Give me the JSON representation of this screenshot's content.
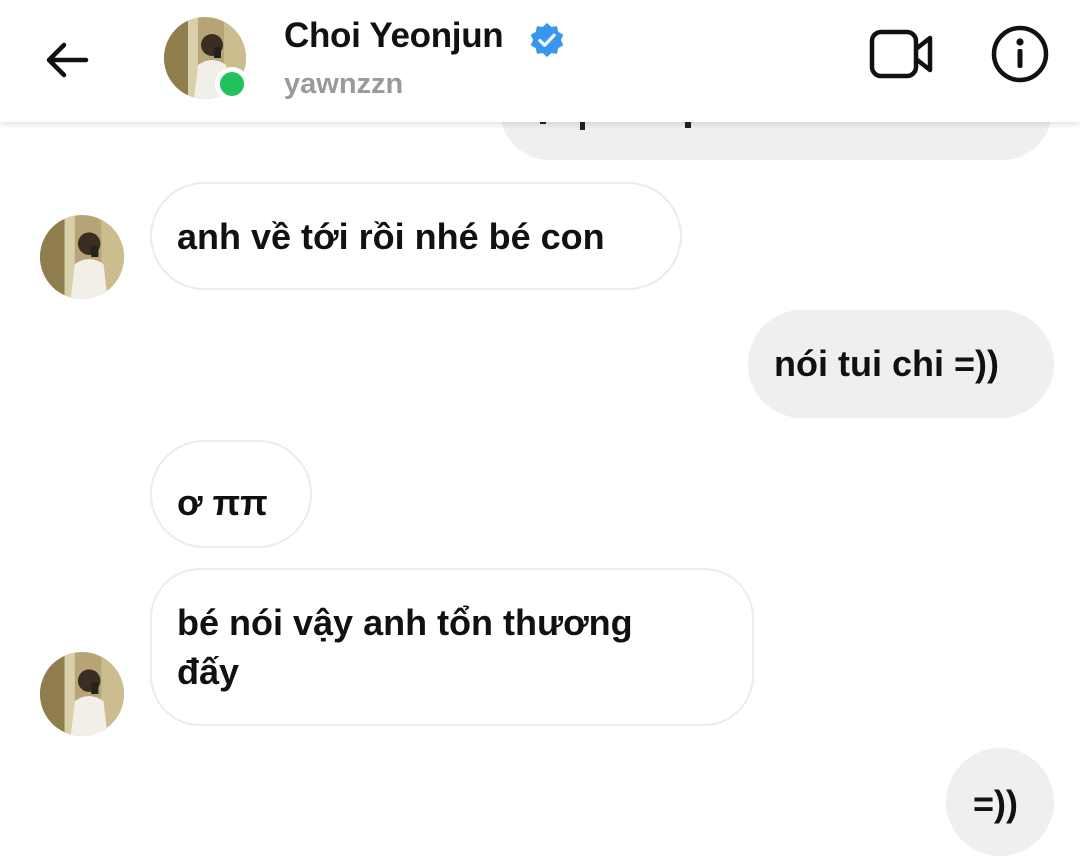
{
  "header": {
    "name": "Choi Yeonjun",
    "username": "yawnzzn",
    "verified": true,
    "online": true,
    "icons": {
      "back": "back-arrow-icon",
      "verified": "verified-badge-icon",
      "video": "video-call-icon",
      "info": "info-icon"
    }
  },
  "colors": {
    "online": "#21c25e",
    "verified": "#3797f0",
    "outgoing_bubble": "#efefef",
    "incoming_border": "#ececec",
    "username": "#9a9a9a"
  },
  "messages": [
    {
      "direction": "outgoing",
      "text": "",
      "partial": true
    },
    {
      "direction": "incoming",
      "text": "anh về tới rồi nhé bé con",
      "avatar": true
    },
    {
      "direction": "outgoing",
      "text": "nói tui chi =))"
    },
    {
      "direction": "incoming",
      "text": "ơ ππ"
    },
    {
      "direction": "incoming",
      "lines": [
        "bé nói vậy anh tổn thương",
        "đấy"
      ],
      "avatar": true
    },
    {
      "direction": "outgoing",
      "text": "=))"
    }
  ]
}
